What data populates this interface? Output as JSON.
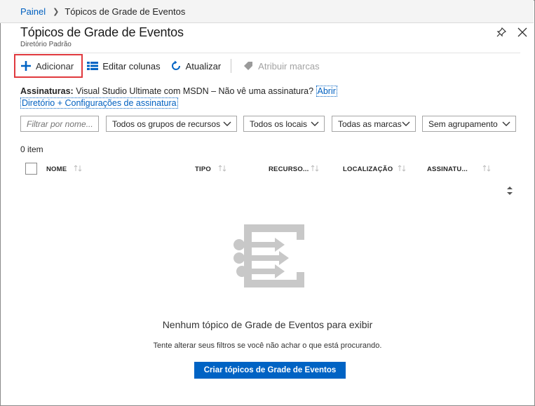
{
  "breadcrumb": {
    "home": "Painel",
    "current": "Tópicos de Grade de Eventos"
  },
  "header": {
    "title": "Tópicos de Grade de Eventos",
    "subtitle": "Diretório Padrão"
  },
  "toolbar": {
    "add_label": "Adicionar",
    "edit_columns_label": "Editar colunas",
    "refresh_label": "Atualizar",
    "assign_tags_label": "Atribuir marcas"
  },
  "subscriptions": {
    "label": "Assinaturas:",
    "value": "Visual Studio Ultimate com MSDN – Não vê uma assinatura?",
    "open_link": "Abrir",
    "directory_link": "Diretório + Configurações de assinatura"
  },
  "filters": {
    "search_placeholder": "Filtrar por nome...",
    "resource_groups": "Todos os grupos de recursos",
    "locations": "Todos os locais",
    "tags": "Todas as marcas",
    "grouping": "Sem agrupamento"
  },
  "list": {
    "count": "0 item",
    "columns": [
      "NOME",
      "TIPO",
      "RECURSO...",
      "LOCALIZAÇÃO",
      "ASSINATU..."
    ]
  },
  "empty_state": {
    "title": "Nenhum tópico de Grade de Eventos para exibir",
    "subtitle": "Tente alterar seus filtros se você não achar o que está procurando.",
    "create_button": "Criar tópicos de Grade de Eventos"
  },
  "colors": {
    "accent": "#0063c4",
    "link": "#0060c0",
    "highlight": "#e0393e",
    "illustration": "#c8c8c8"
  }
}
